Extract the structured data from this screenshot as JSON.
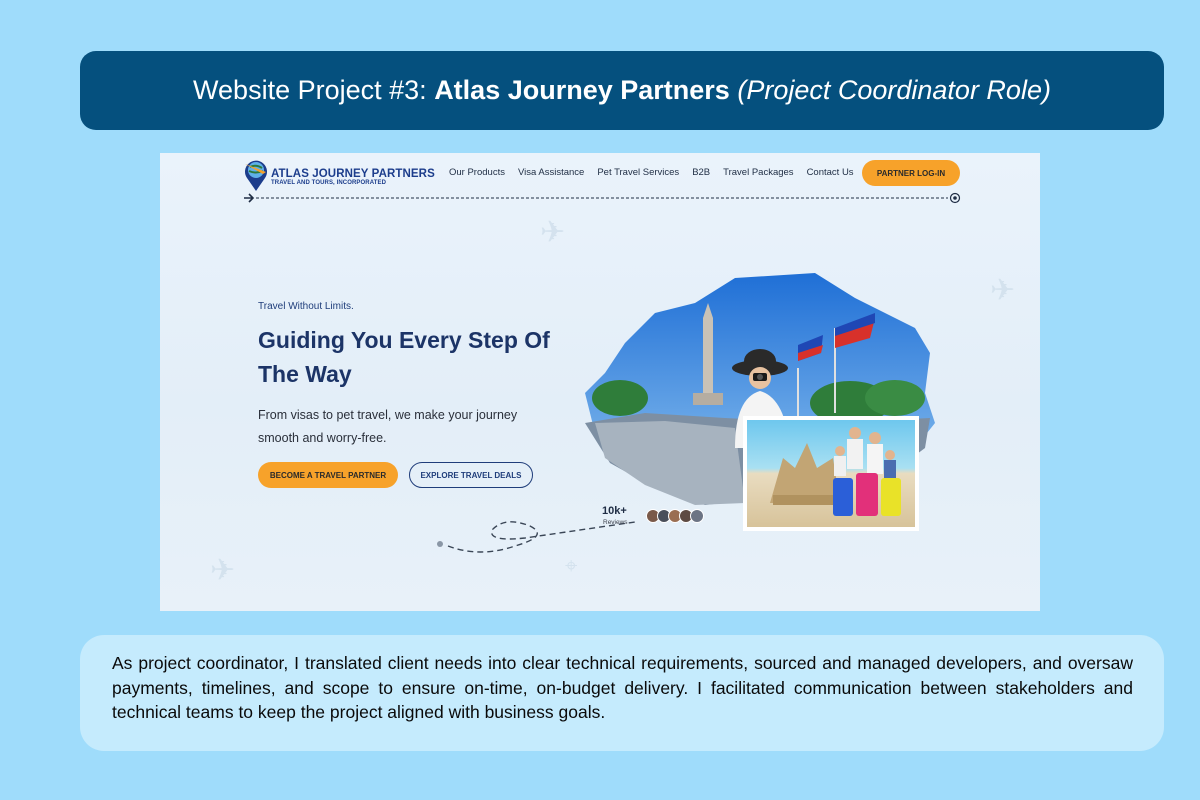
{
  "header": {
    "prefix": "Website Project #3:",
    "project_name": "Atlas Journey Partners",
    "role": "(Project Coordinator Role)"
  },
  "site": {
    "logo": {
      "name": "ATLAS JOURNEY PARTNERS",
      "subtitle": "TRAVEL AND TOURS, INCORPORATED"
    },
    "nav": {
      "items": [
        {
          "label": "Our Products"
        },
        {
          "label": "Visa Assistance"
        },
        {
          "label": "Pet Travel Services"
        },
        {
          "label": "B2B"
        },
        {
          "label": "Travel Packages"
        },
        {
          "label": "Contact Us"
        }
      ],
      "login_label": "PARTNER LOG-IN"
    },
    "hero": {
      "eyebrow": "Travel Without Limits.",
      "headline": "Guiding You Every Step Of The Way",
      "subtext": "From visas to pet travel, we make your journey smooth and worry-free.",
      "primary_cta": "BECOME A TRAVEL PARTNER",
      "secondary_cta": "EXPLORE TRAVEL DEALS",
      "reviews_count": "10k+",
      "reviews_label": "Reviews"
    },
    "colors": {
      "accent": "#f7a22a",
      "brand": "#1c3467"
    }
  },
  "description": "As project coordinator, I translated client needs into clear technical requirements, sourced and managed developers, and oversaw payments, timelines, and scope to ensure on-time, on-budget delivery. I facilitated communication between stakeholders and technical teams to keep the project aligned with business goals."
}
